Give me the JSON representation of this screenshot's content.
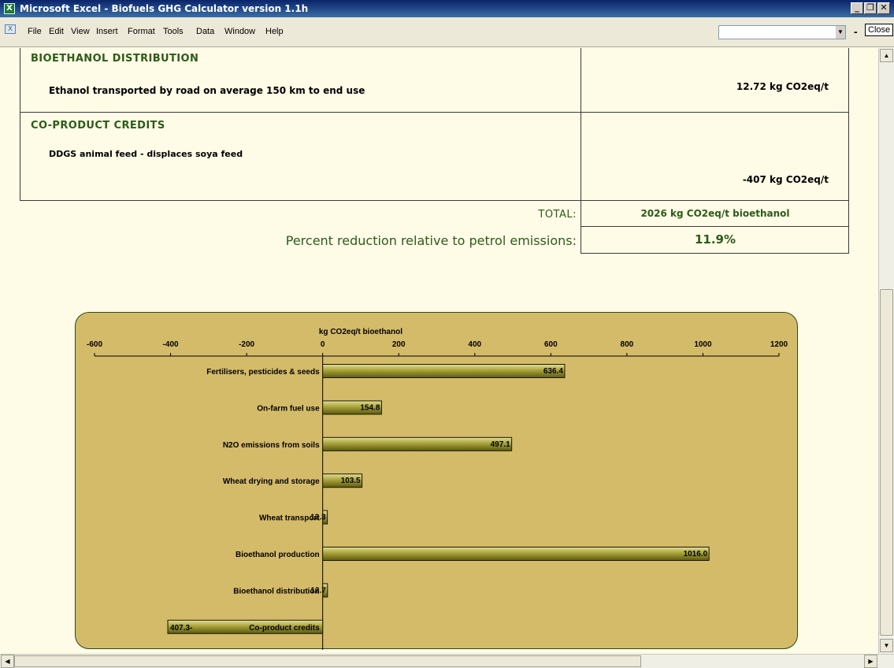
{
  "window": {
    "title": "Microsoft Excel - Biofuels GHG Calculator version 1.1h",
    "app_icon": "excel-icon",
    "controls": {
      "minimize": "_",
      "restore": "❐",
      "close": "✕"
    }
  },
  "menubar": {
    "items": [
      "File",
      "Edit",
      "View",
      "Insert",
      "Format",
      "Tools",
      "Data",
      "Window",
      "Help"
    ],
    "close_label": "Close"
  },
  "sheet": {
    "distribution": {
      "heading": "BIOETHANOL DISTRIBUTION",
      "description": "Ethanol transported by road on average 150 km to end use",
      "value": "12.72 kg CO2eq/t"
    },
    "credits": {
      "heading": "CO-PRODUCT CREDITS",
      "description": "DDGS animal feed - displaces soya feed",
      "value": "-407 kg CO2eq/t"
    },
    "total": {
      "label": "TOTAL:",
      "value": "2026 kg CO2eq/t bioethanol"
    },
    "reduction": {
      "label": "Percent reduction relative to petrol emissions:",
      "value": "11.9%"
    }
  },
  "colors": {
    "heading_green": "#2d5b1a",
    "chart_bg": "#d4bb6a",
    "sheet_bg": "#fefbe6"
  },
  "chart_data": {
    "type": "bar",
    "orientation": "horizontal",
    "title": "kg CO2eq/t bioethanol",
    "xlim": [
      -600,
      1200
    ],
    "ticks": [
      -600,
      -400,
      -200,
      0,
      200,
      400,
      600,
      800,
      1000,
      1200
    ],
    "categories": [
      "Fertilisers, pesticides & seeds",
      "On-farm fuel use",
      "N2O emissions from soils",
      "Wheat drying and storage",
      "Wheat transport",
      "Bioethanol production",
      "Bioethanol distribution",
      "Co-product credits"
    ],
    "values": [
      636.4,
      154.8,
      497.1,
      103.5,
      12.3,
      1016.0,
      12.7,
      -407.3
    ],
    "data_labels": [
      "636.4",
      "154.8",
      "497.1",
      "103.5",
      "12.3",
      "1016.0",
      "12.7",
      "407.3-"
    ]
  }
}
